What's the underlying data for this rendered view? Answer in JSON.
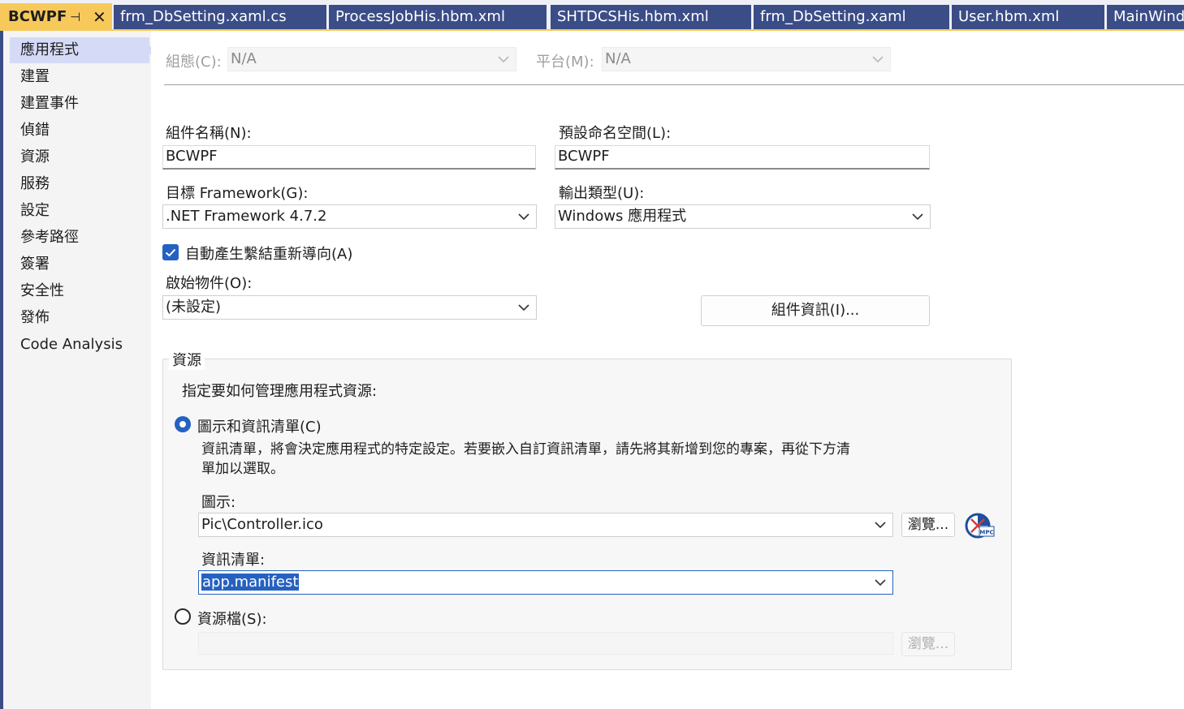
{
  "tabs": [
    {
      "label": "BCWPF",
      "active": true
    },
    {
      "label": "frm_DbSetting.xaml.cs"
    },
    {
      "label": "ProcessJobHis.hbm.xml"
    },
    {
      "label": "SHTDCSHis.hbm.xml"
    },
    {
      "label": "frm_DbSetting.xaml"
    },
    {
      "label": "User.hbm.xml"
    },
    {
      "label": "MainWind"
    }
  ],
  "tab_icons": {
    "pin": "pin-icon",
    "close": "close-icon"
  },
  "sidebar": {
    "items": [
      {
        "label": "應用程式",
        "selected": true
      },
      {
        "label": "建置"
      },
      {
        "label": "建置事件"
      },
      {
        "label": "偵錯"
      },
      {
        "label": "資源"
      },
      {
        "label": "服務"
      },
      {
        "label": "設定"
      },
      {
        "label": "參考路徑"
      },
      {
        "label": "簽署"
      },
      {
        "label": "安全性"
      },
      {
        "label": "發佈"
      },
      {
        "label": "Code Analysis"
      }
    ]
  },
  "config": {
    "config_label": "組態(C):",
    "config_value": "N/A",
    "platform_label": "平台(M):",
    "platform_value": "N/A"
  },
  "app": {
    "assembly_name_label": "組件名稱(N):",
    "assembly_name_value": "BCWPF",
    "default_namespace_label": "預設命名空間(L):",
    "default_namespace_value": "BCWPF",
    "target_framework_label": "目標 Framework(G):",
    "target_framework_value": ".NET Framework 4.7.2",
    "output_type_label": "輸出類型(U):",
    "output_type_value": "Windows 應用程式",
    "auto_redirect_label": "自動產生繫結重新導向(A)",
    "auto_redirect_checked": true,
    "startup_object_label": "啟始物件(O):",
    "startup_object_value": "(未設定)",
    "assembly_info_button": "組件資訊(I)..."
  },
  "resources": {
    "group_title": "資源",
    "instruction": "指定要如何管理應用程式資源:",
    "icon_manifest_option": "圖示和資訊清單(C)",
    "icon_manifest_selected": true,
    "description_line1": "資訊清單，將會決定應用程式的特定設定。若要嵌入自訂資訊清單，請先將其新增到您的專案，再從下方清",
    "description_line2": "單加以選取。",
    "icon_label": "圖示:",
    "icon_value": "Pic\\Controller.ico",
    "browse_label": "瀏覽...",
    "manifest_label": "資訊清單:",
    "manifest_value": "app.manifest",
    "resource_file_option": "資源檔(S):",
    "resource_file_value": "",
    "browse_disabled_label": "瀏覽...",
    "icon_preview": "mpc-icon"
  },
  "colors": {
    "accent": "#2561c0",
    "tab_active": "#f7c95a",
    "tab_inactive": "#3b4d87",
    "sidebar_selected": "#d5dbf6"
  }
}
